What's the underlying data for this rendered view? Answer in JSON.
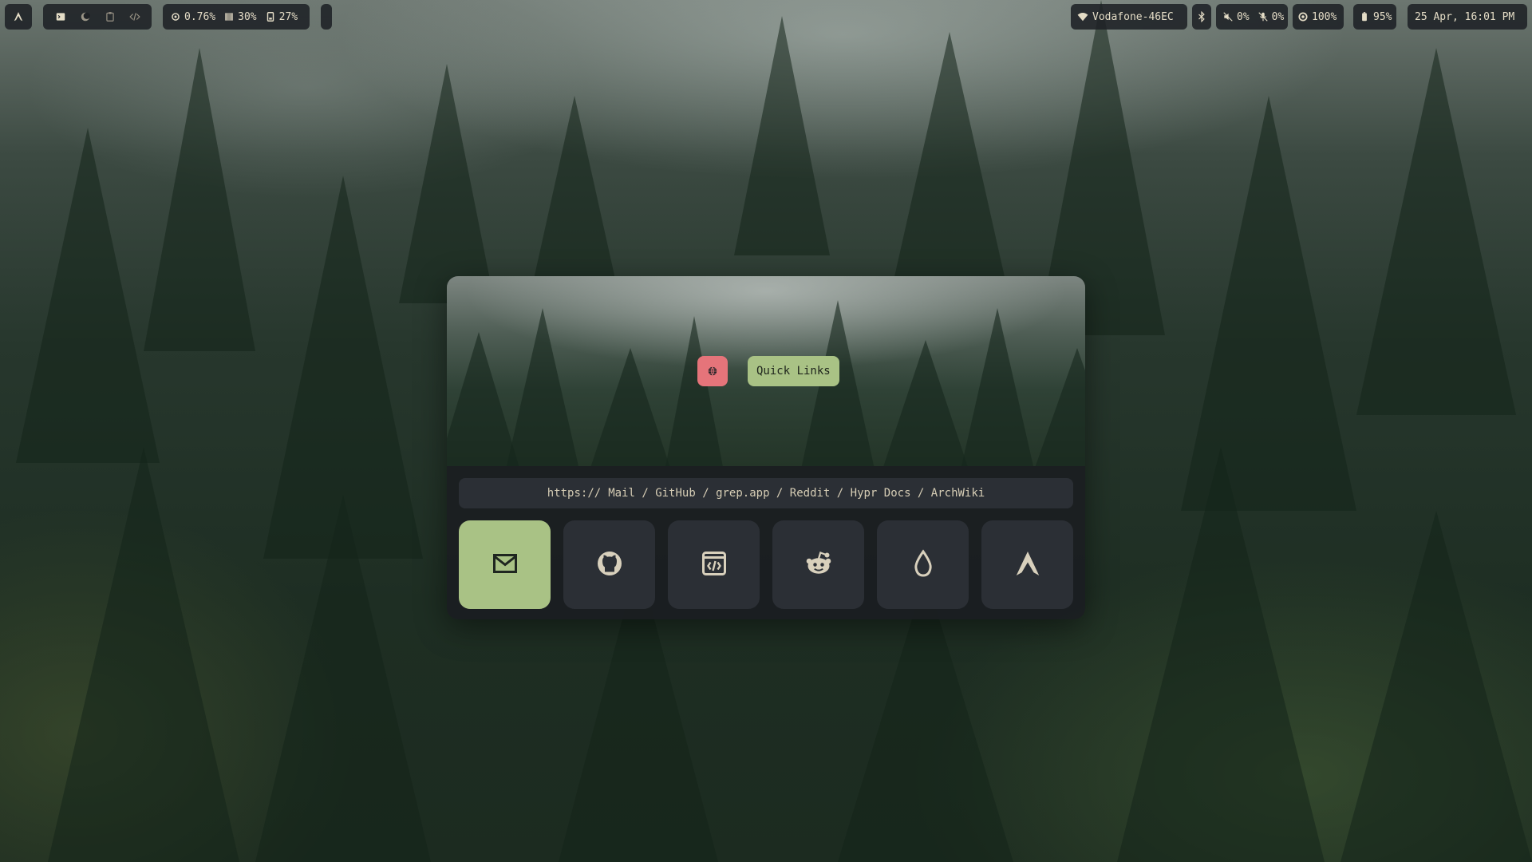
{
  "topbar": {
    "launcher_icon": "arch-icon",
    "workspaces": [
      {
        "icon": "terminal-icon"
      },
      {
        "icon": "moon-icon"
      },
      {
        "icon": "clipboard-icon"
      },
      {
        "icon": "code-icon"
      }
    ],
    "stats": {
      "cpu": "0.76%",
      "memory": "30%",
      "disk": "27%"
    },
    "wifi": "Vodafone-46EC",
    "bluetooth_icon": "bluetooth-icon",
    "volume": "0%",
    "mic": "0%",
    "brightness": "100%",
    "battery": "95%",
    "datetime": "25 Apr, 16:01 PM"
  },
  "widget": {
    "globe_icon": "globe-icon",
    "title": "Quick Links",
    "url_prefix": "https://",
    "url_links": "Mail / GitHub / grep.app / Reddit / Hypr Docs / ArchWiki",
    "links": [
      {
        "name": "Mail",
        "icon": "mail-icon",
        "active": true
      },
      {
        "name": "GitHub",
        "icon": "github-icon",
        "active": false
      },
      {
        "name": "grep.app",
        "icon": "code-window-icon",
        "active": false
      },
      {
        "name": "Reddit",
        "icon": "reddit-icon",
        "active": false
      },
      {
        "name": "Hypr Docs",
        "icon": "droplet-icon",
        "active": false
      },
      {
        "name": "ArchWiki",
        "icon": "arch-icon",
        "active": false
      }
    ],
    "colors": {
      "accent_green": "#a9c285",
      "accent_red": "#e5747a",
      "tile_bg": "#2b2f35",
      "panel_bg": "#1b1e21"
    }
  }
}
